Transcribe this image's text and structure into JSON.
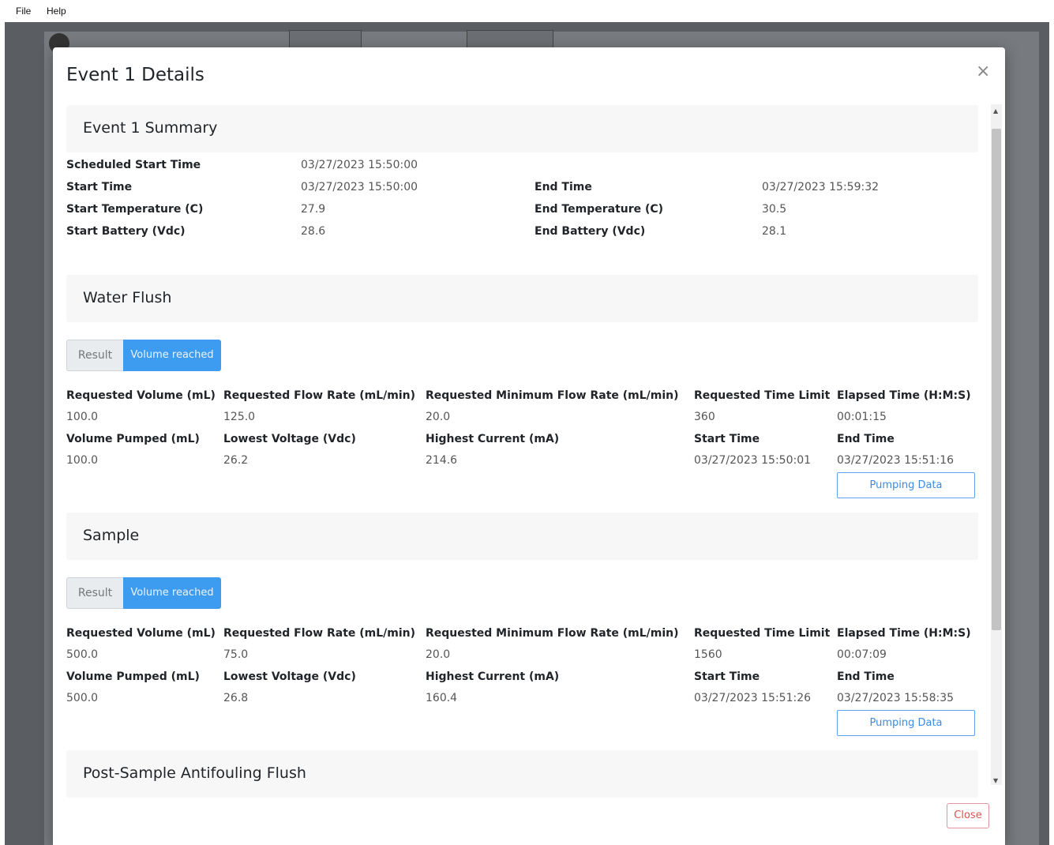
{
  "menu": [
    "File",
    "Help"
  ],
  "modal": {
    "title": "Event 1 Details",
    "close_glyph": "×",
    "close_button": "Close"
  },
  "summary": {
    "heading": "Event 1 Summary",
    "scheduled_start_label": "Scheduled Start Time",
    "scheduled_start": "03/27/2023 15:50:00",
    "start_time_label": "Start Time",
    "start_time": "03/27/2023 15:50:00",
    "start_temp_label": "Start Temperature (C)",
    "start_temp": "27.9",
    "start_battery_label": "Start Battery (Vdc)",
    "start_battery": "28.6",
    "end_time_label": "End Time",
    "end_time": "03/27/2023 15:59:32",
    "end_temp_label": "End Temperature (C)",
    "end_temp": "30.5",
    "end_battery_label": "End Battery (Vdc)",
    "end_battery": "28.1"
  },
  "labels": {
    "result": "Result",
    "req_volume": "Requested Volume (mL)",
    "req_flow": "Requested Flow Rate (mL/min)",
    "req_min_flow": "Requested Minimum Flow Rate (mL/min)",
    "req_time_limit": "Requested Time Limit",
    "elapsed": "Elapsed Time (H:M:S)",
    "vol_pumped": "Volume Pumped (mL)",
    "lowest_voltage": "Lowest Voltage (Vdc)",
    "highest_current": "Highest Current (mA)",
    "start_time": "Start Time",
    "end_time": "End Time",
    "pumping_data": "Pumping Data"
  },
  "water_flush": {
    "heading": "Water Flush",
    "result": "Volume reached",
    "req_volume": "100.0",
    "req_flow": "125.0",
    "req_min_flow": "20.0",
    "req_time_limit": "360",
    "elapsed": "00:01:15",
    "vol_pumped": "100.0",
    "lowest_voltage": "26.2",
    "highest_current": "214.6",
    "start_time": "03/27/2023 15:50:01",
    "end_time": "03/27/2023 15:51:16"
  },
  "sample": {
    "heading": "Sample",
    "result": "Volume reached",
    "req_volume": "500.0",
    "req_flow": "75.0",
    "req_min_flow": "20.0",
    "req_time_limit": "1560",
    "elapsed": "00:07:09",
    "vol_pumped": "500.0",
    "lowest_voltage": "26.8",
    "highest_current": "160.4",
    "start_time": "03/27/2023 15:51:26",
    "end_time": "03/27/2023 15:58:35"
  },
  "post_sample": {
    "heading": "Post-Sample Antifouling Flush"
  },
  "colors": {
    "accent": "#3d9bf0",
    "danger": "#d9534f"
  }
}
